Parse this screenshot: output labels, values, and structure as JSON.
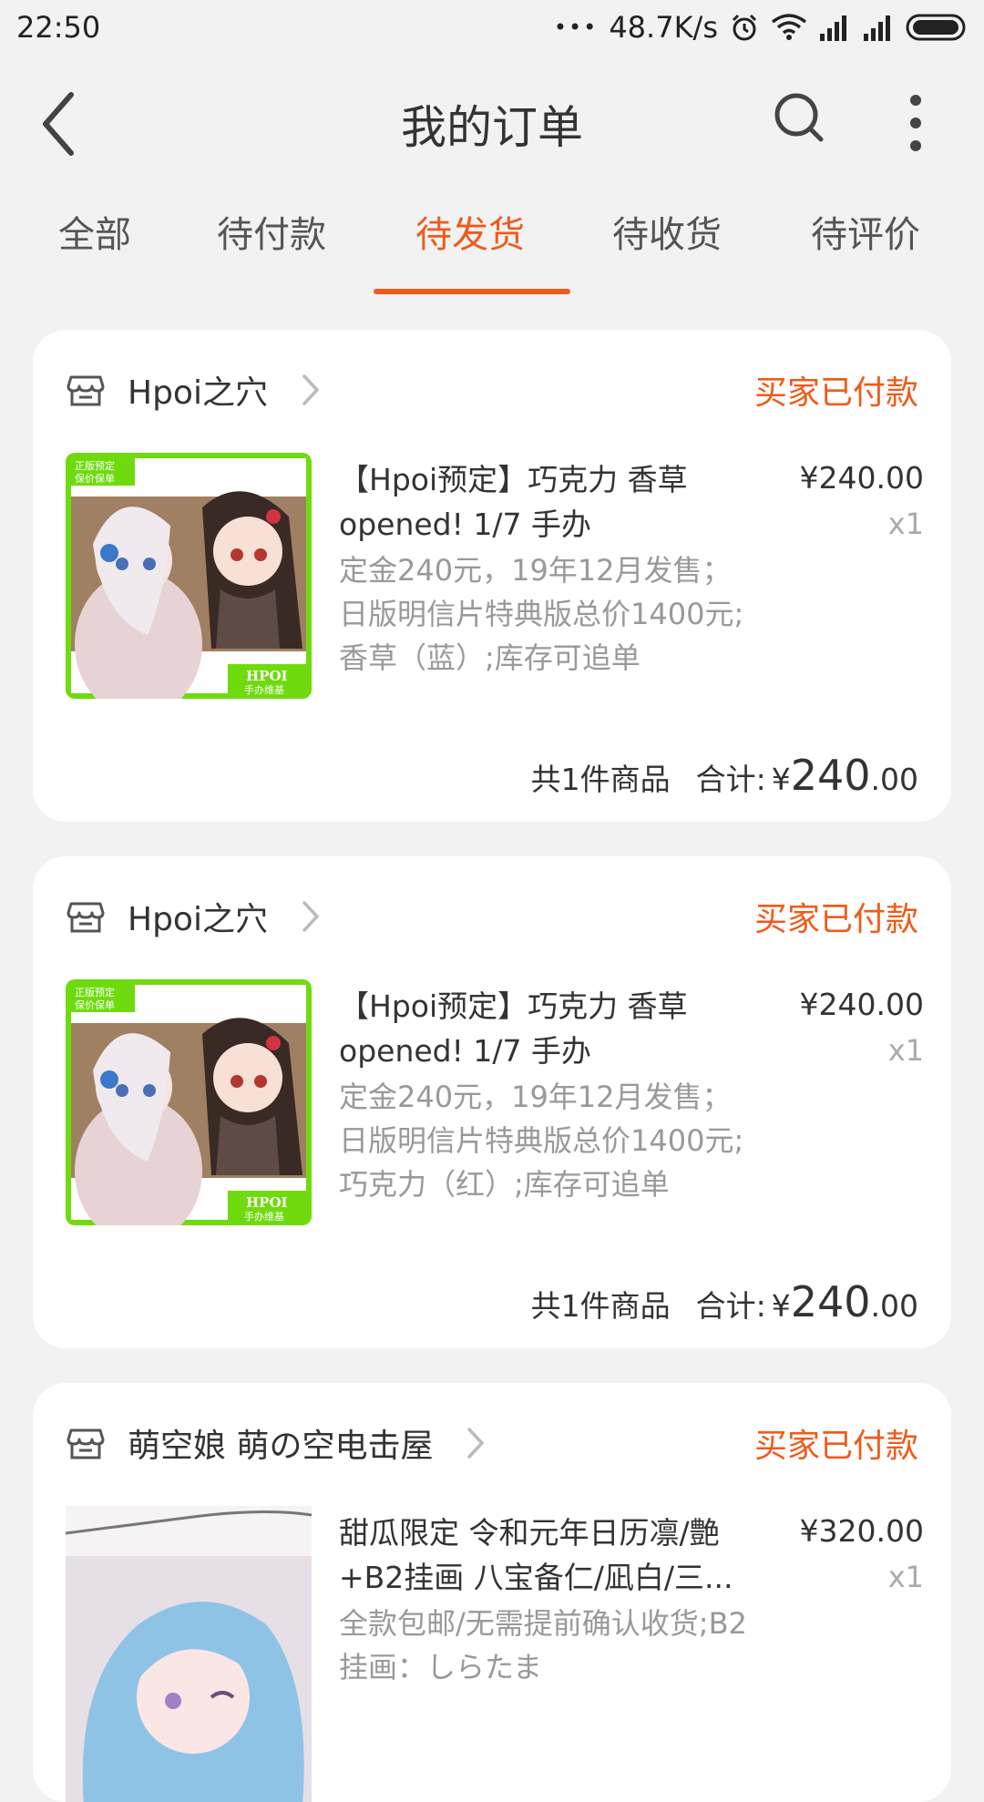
{
  "status_bar": {
    "time": "22:50",
    "dots": "•••",
    "net_speed": "48.7K/s"
  },
  "header": {
    "title": "我的订单"
  },
  "tabs": [
    {
      "label": "全部"
    },
    {
      "label": "待付款"
    },
    {
      "label": "待发货"
    },
    {
      "label": "待收货"
    },
    {
      "label": "待评价"
    }
  ],
  "active_tab": "待发货",
  "colors": {
    "accent": "#f05a1a",
    "background": "#f2f2f2"
  },
  "orders": [
    {
      "shop": "Hpoi之穴",
      "status": "买家已付款",
      "title": "【Hpoi预定】巧克力 香草 opened! 1/7 手办",
      "desc": "定金240元，19年12月发售；日版明信片特典版总价1400元;香草（蓝）;库存可追单",
      "price": "¥240.00",
      "qty": "x1",
      "count_text": "共1件商品",
      "total_label": "合计:",
      "total_currency": "¥",
      "total_int": "240",
      "total_dec": ".00",
      "thumb_badge_top": "正版预定 保价保单",
      "thumb_badge_bottom": "HPOI 手办维基"
    },
    {
      "shop": "Hpoi之穴",
      "status": "买家已付款",
      "title": "【Hpoi预定】巧克力 香草 opened! 1/7 手办",
      "desc": "定金240元，19年12月发售；日版明信片特典版总价1400元;巧克力（红）;库存可追单",
      "price": "¥240.00",
      "qty": "x1",
      "count_text": "共1件商品",
      "total_label": "合计:",
      "total_currency": "¥",
      "total_int": "240",
      "total_dec": ".00",
      "thumb_badge_top": "正版预定 保价保单",
      "thumb_badge_bottom": "HPOI 手办维基"
    },
    {
      "shop": "萌空娘 萌の空电击屋",
      "status": "买家已付款",
      "title": "甜瓜限定 令和元年日历凛/艶+B2挂画 八宝备仁/凪白/三...",
      "desc": "全款包邮/无需提前确认收货;B2挂画：しらたま",
      "price": "¥320.00",
      "qty": "x1"
    }
  ]
}
